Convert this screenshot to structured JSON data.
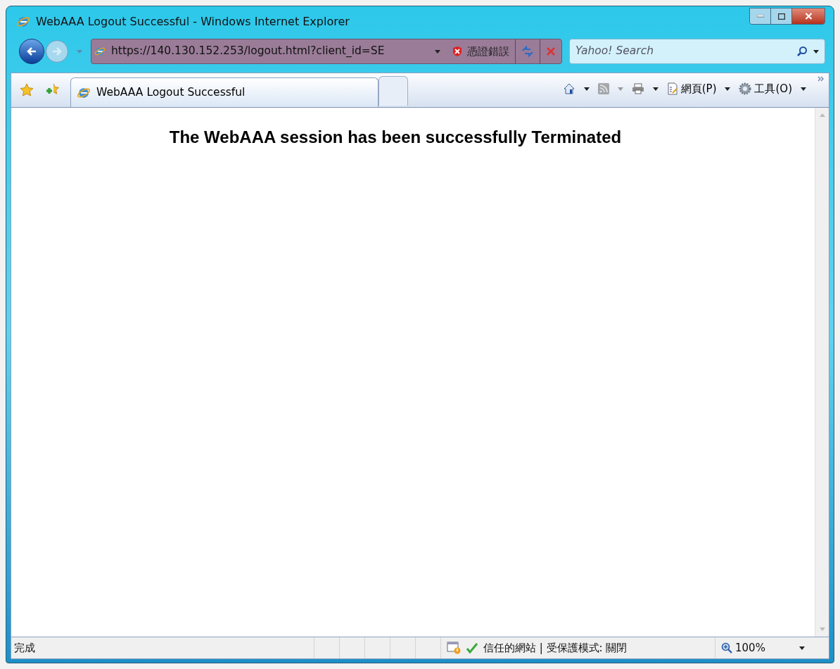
{
  "window": {
    "title": "WebAAA Logout Successful - Windows Internet Explorer"
  },
  "address_bar": {
    "url": "https://140.130.152.253/logout.html?client_id=SE",
    "certificate_error": "憑證錯誤"
  },
  "search": {
    "placeholder": "Yahoo! Search"
  },
  "tabs": [
    {
      "label": "WebAAA Logout Successful",
      "selected": true
    },
    {
      "selected": false
    }
  ],
  "command_bar": [
    {
      "kind": "home"
    },
    {
      "kind": "feeds",
      "disabled": true
    },
    {
      "kind": "print"
    },
    {
      "kind": "page",
      "label": "網頁(P)"
    },
    {
      "kind": "tools",
      "label": "工具(O)"
    }
  ],
  "content": {
    "heading": "The WebAAA session has been successfully Terminated"
  },
  "status_bar": {
    "status": "完成",
    "zone": "信任的網站 | 受保護模式: 關閉",
    "zoom": "100%"
  }
}
